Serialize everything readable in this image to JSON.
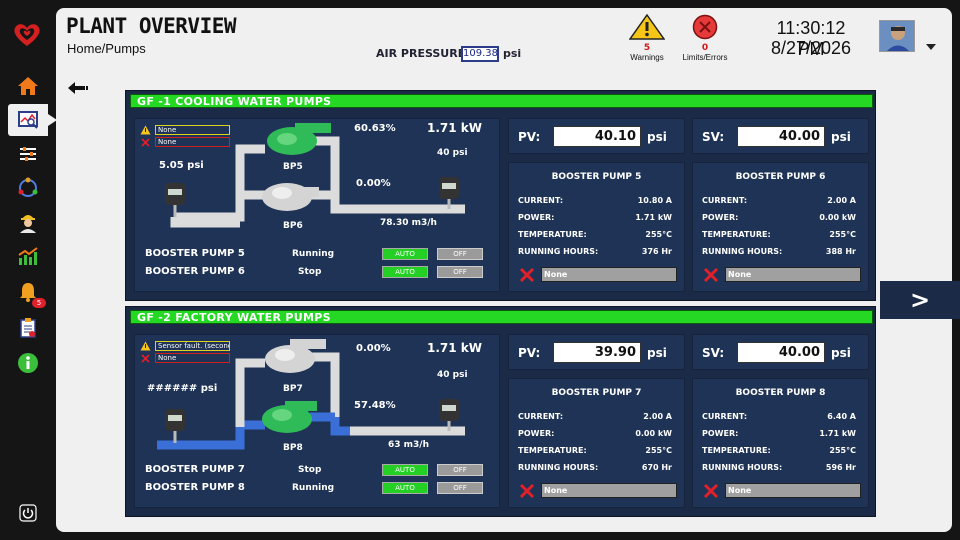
{
  "header": {
    "title": "PLANT OVERVIEW",
    "breadcrumb": "Home/Pumps",
    "air_pressure_label": "AIR PRESSURE:",
    "air_pressure_value": "109.38",
    "air_pressure_unit": "psi",
    "warnings_count": "5",
    "warnings_label": "Warnings",
    "errors_count": "0",
    "errors_label": "Limits/Errors",
    "time": "11:30:12 PM",
    "date": "8/27/2026"
  },
  "sidebar": {
    "items": [
      {
        "name": "home-icon"
      },
      {
        "name": "monitor-icon"
      },
      {
        "name": "sliders-icon"
      },
      {
        "name": "cycle-icon"
      },
      {
        "name": "worker-icon"
      },
      {
        "name": "trend-chart-icon"
      },
      {
        "name": "bell-icon",
        "badge": "5"
      },
      {
        "name": "report-icon"
      },
      {
        "name": "info-icon"
      },
      {
        "name": "power-icon"
      }
    ]
  },
  "groups": [
    {
      "header": "GF -1 COOLING WATER PUMPS",
      "messages": [
        "None",
        "None"
      ],
      "inlet_pressure": "5.05 psi",
      "upper_pump": "BP5",
      "lower_pump": "BP6",
      "upper_speed": "60.63%",
      "lower_speed": "0.00%",
      "power": "1.71 kW",
      "outlet_pressure": "40 psi",
      "flow": "78.30 m3/h",
      "rows": [
        {
          "name": "BOOSTER PUMP 5",
          "status": "Running",
          "auto": "AUTO",
          "off": "OFF"
        },
        {
          "name": "BOOSTER PUMP 6",
          "status": "Stop",
          "auto": "AUTO",
          "off": "OFF"
        }
      ],
      "pv_label": "PV:",
      "pv_value": "40.10",
      "pv_unit": "psi",
      "sv_label": "SV:",
      "sv_value": "40.00",
      "sv_unit": "psi",
      "cards": [
        {
          "title": "BOOSTER PUMP 5",
          "current": "10.80 A",
          "power": "1.71 kW",
          "temperature": "255°C",
          "hours": "376 Hr",
          "error": "None"
        },
        {
          "title": "BOOSTER PUMP 6",
          "current": "2.00 A",
          "power": "0.00 kW",
          "temperature": "255°C",
          "hours": "388 Hr",
          "error": "None"
        }
      ]
    },
    {
      "header": "GF -2 FACTORY WATER PUMPS",
      "messages": [
        "Sensor fault. (second",
        "None"
      ],
      "inlet_pressure": "###### psi",
      "upper_pump": "BP7",
      "lower_pump": "BP8",
      "upper_speed": "0.00%",
      "lower_speed": "57.48%",
      "power": "1.71 kW",
      "outlet_pressure": "40 psi",
      "flow": "63 m3/h",
      "rows": [
        {
          "name": "BOOSTER PUMP 7",
          "status": "Stop",
          "auto": "AUTO",
          "off": "OFF"
        },
        {
          "name": "BOOSTER PUMP 8",
          "status": "Running",
          "auto": "AUTO",
          "off": "OFF"
        }
      ],
      "pv_label": "PV:",
      "pv_value": "39.90",
      "pv_unit": "psi",
      "sv_label": "SV:",
      "sv_value": "40.00",
      "sv_unit": "psi",
      "cards": [
        {
          "title": "BOOSTER PUMP 7",
          "current": "2.00 A",
          "power": "0.00 kW",
          "temperature": "255°C",
          "hours": "670 Hr",
          "error": "None"
        },
        {
          "title": "BOOSTER PUMP 8",
          "current": "6.40 A",
          "power": "1.71 kW",
          "temperature": "255°C",
          "hours": "596 Hr",
          "error": "None"
        }
      ]
    }
  ],
  "card_labels": {
    "current": "CURRENT:",
    "power": "POWER:",
    "temperature": "TEMPERATURE:",
    "hours": "RUNNING HOURS:"
  },
  "next_label": ">",
  "colors": {
    "header_green": "#24d824",
    "panel_navy": "#1b2a47",
    "running_green": "#25d025",
    "pipe_blue": "#3a6fd8"
  }
}
